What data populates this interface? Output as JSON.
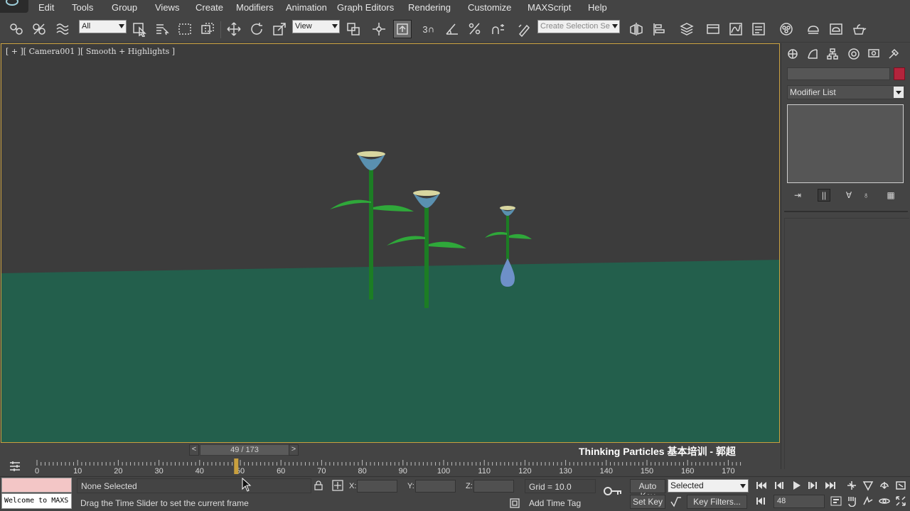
{
  "menu": {
    "items": [
      "Edit",
      "Tools",
      "Group",
      "Views",
      "Create",
      "Modifiers",
      "Animation",
      "Graph Editors",
      "Rendering",
      "Customize",
      "MAXScript",
      "Help"
    ]
  },
  "toolbar": {
    "selection_filter": "All",
    "reference_coord": "View",
    "named_selection_placeholder": "Create Selection Se",
    "snap_label": "3"
  },
  "viewport": {
    "label": "[ + ][ Camera001 ][ Smooth + Highlights ]",
    "colors": {
      "background": "#3c3c3c",
      "ground": "#235f4c",
      "border": "#c9a03e",
      "stem": "#1f8a28",
      "leaf": "#2fa83a",
      "bloom": "#5a90b0",
      "droplet": "#6e90c8"
    }
  },
  "command_panel": {
    "modifier_list": "Modifier List",
    "color_swatch": "#b4243c"
  },
  "timeline": {
    "slider_label": "49 / 173",
    "prev": "<",
    "next": ">",
    "current_frame": 49,
    "total_frames": 173,
    "ticks": [
      "0",
      "10",
      "20",
      "30",
      "40",
      "50",
      "60",
      "70",
      "80",
      "90",
      "100",
      "110",
      "120",
      "130",
      "140",
      "150",
      "160",
      "170"
    ]
  },
  "caption": "Thinking Particles 基本培训 - 郭超",
  "status": {
    "maxscript_output": "Welcome to MAXS",
    "selection": "None Selected",
    "prompt": "Drag the Time Slider to set the current frame",
    "x_label": "X:",
    "y_label": "Y:",
    "z_label": "Z:",
    "grid": "Grid = 10.0",
    "add_time_tag": "Add Time Tag"
  },
  "animation_controls": {
    "auto_key": "Auto Key",
    "set_key": "Set Key",
    "key_mode": "Selected",
    "key_filters": "Key Filters...",
    "frame": "48"
  }
}
